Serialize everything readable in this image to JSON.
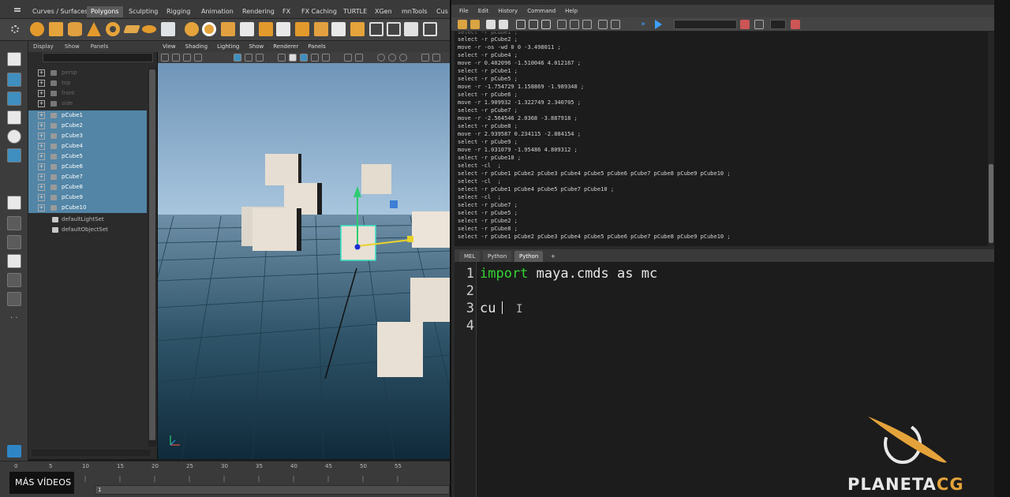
{
  "shelf": {
    "tabs": [
      "Curves / Surfaces",
      "Polygons",
      "Sculpting",
      "Rigging",
      "Animation",
      "Rendering",
      "FX",
      "FX Caching",
      "TURTLE",
      "XGen",
      "mnTools",
      "Cus"
    ],
    "active_tab": "Polygons"
  },
  "outliner": {
    "menu": [
      "Display",
      "Show",
      "Panels"
    ],
    "cameras": [
      "persp",
      "top",
      "front",
      "side"
    ],
    "cubes": [
      "pCube1",
      "pCube2",
      "pCube3",
      "pCube4",
      "pCube5",
      "pCube6",
      "pCube7",
      "pCube8",
      "pCube9",
      "pCube10"
    ],
    "sets": [
      "defaultLightSet",
      "defaultObjectSet"
    ]
  },
  "viewport": {
    "menu": [
      "View",
      "Shading",
      "Lighting",
      "Show",
      "Renderer",
      "Panels"
    ]
  },
  "timeline": {
    "ticks": [
      "0",
      "5",
      "10",
      "15",
      "20",
      "25",
      "30",
      "35",
      "40",
      "45",
      "50",
      "55"
    ],
    "range_start": "1"
  },
  "overlay": {
    "more_videos": "MÁS VÍDEOS"
  },
  "script_editor": {
    "menu": [
      "File",
      "Edit",
      "History",
      "Command",
      "Help"
    ],
    "history": [
      "select -r pCube2 ;",
      "move -r -os -wd 0 0 -3.498011 ;",
      "select -r pCube4 ;",
      "move -r 0.402096 -1.510046 4.012167 ;",
      "select -r pCube1 ;",
      "select -r pCube5 ;",
      "move -r -1.754729 1.158869 -1.989348 ;",
      "select -r pCube6 ;",
      "move -r 1.909932 -1.322749 2.340705 ;",
      "select -r pCube7 ;",
      "move -r -2.564546 2.0368 -3.887918 ;",
      "select -r pCube8 ;",
      "move -r 2.939587 0.234115 -2.884154 ;",
      "select -r pCube9 ;",
      "move -r 1.031079 -1.95486 4.809312 ;",
      "select -r pCube10 ;",
      "select -cl  ;",
      "select -r pCube1 pCube2 pCube3 pCube4 pCube5 pCube6 pCube7 pCube8 pCube9 pCube10 ;",
      "select -cl  ;",
      "select -r pCube1 pCube4 pCube5 pCube7 pCube10 ;",
      "select -cl  ;",
      "select -r pCube7 ;",
      "select -r pCube5 ;",
      "select -r pCube2 ;",
      "select -r pCube8 ;",
      "select -r pCube1 pCube2 pCube3 pCube4 pCube5 pCube6 pCube7 pCube8 pCube9 pCube10 ;"
    ],
    "tabs": [
      "MEL",
      "Python",
      "Python",
      "+"
    ],
    "active_tab_index": 2,
    "line_numbers": [
      "1",
      "2",
      "3",
      "4"
    ],
    "code": {
      "line1_keyword": "import",
      "line1_rest": " maya.cmds as mc",
      "line3": "cu"
    }
  },
  "logo": {
    "text_a": "PLANETA",
    "text_b": "CG"
  },
  "colors": {
    "selection": "#5285a6",
    "keyword": "#33d433",
    "logo_accent": "#e4a33a",
    "viewport_sky": "#a9c6de",
    "viewport_ground": "#2f5469"
  }
}
